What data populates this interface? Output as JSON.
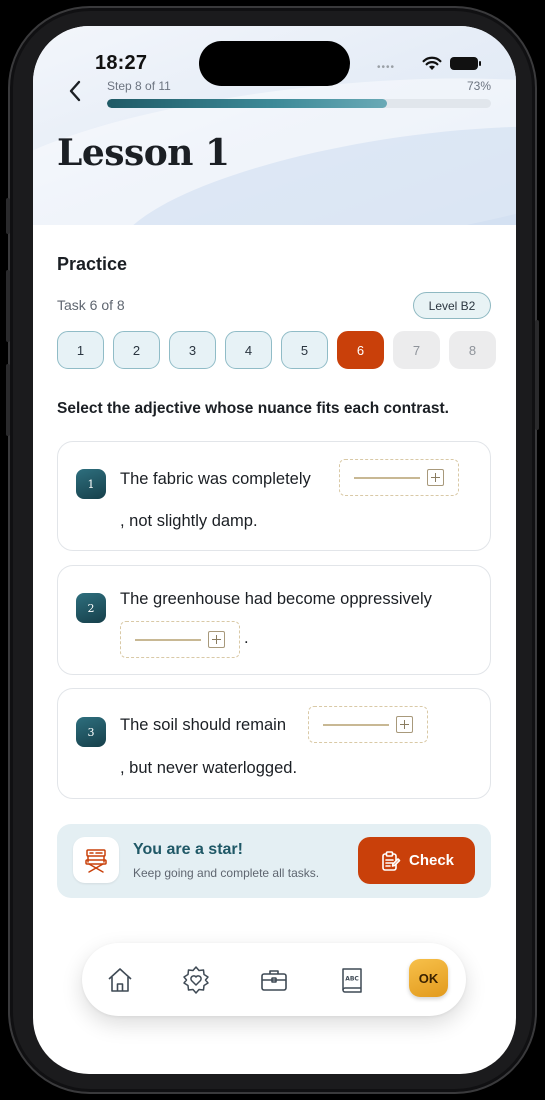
{
  "status_bar": {
    "time": "18:27",
    "signal_dots": "••••"
  },
  "header": {
    "step_label": "Step 8 of 11",
    "progress_percent_label": "73%",
    "progress_fraction": 0.73,
    "title": "Lesson 1"
  },
  "practice": {
    "section_title": "Practice",
    "task_counter": "Task 6 of 8",
    "level_badge": "Level B2",
    "tasks": [
      {
        "label": "1",
        "state": "done"
      },
      {
        "label": "2",
        "state": "done"
      },
      {
        "label": "3",
        "state": "done"
      },
      {
        "label": "4",
        "state": "done"
      },
      {
        "label": "5",
        "state": "done"
      },
      {
        "label": "6",
        "state": "current"
      },
      {
        "label": "7",
        "state": "locked"
      },
      {
        "label": "8",
        "state": "locked"
      }
    ],
    "instruction": "Select the adjective whose nuance fits each contrast.",
    "items": [
      {
        "number": "1",
        "before": "The fabric was completely",
        "after": ", not slightly damp."
      },
      {
        "number": "2",
        "before": "The greenhouse had become oppressively",
        "after": "."
      },
      {
        "number": "3",
        "before": "The soil should remain",
        "after": ", but never waterlogged."
      }
    ]
  },
  "banner": {
    "title": "You are a star!",
    "subtitle": "Keep going and complete all tasks.",
    "check_label": "Check",
    "icon": "director-chair-icon"
  },
  "tabbar": {
    "items": [
      "home-icon",
      "badge-heart-icon",
      "briefcase-icon",
      "abc-book-icon"
    ],
    "ok_label": "OK"
  },
  "colors": {
    "accent": "#c9400a",
    "teal": "#1f5866",
    "progress": "#3d8a98"
  }
}
